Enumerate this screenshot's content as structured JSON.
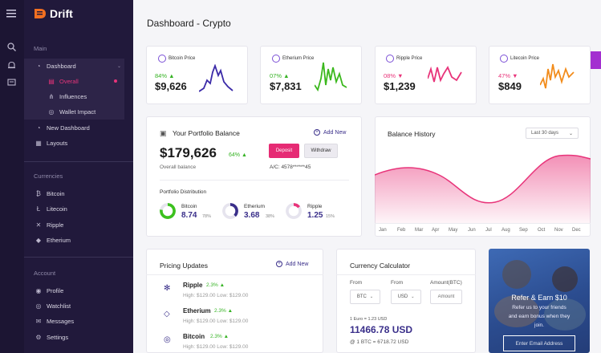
{
  "app": {
    "name": "Drift"
  },
  "page": {
    "title": "Dashboard - Crypto"
  },
  "sidebar": {
    "main_heading": "Main",
    "dashboard": "Dashboard",
    "sub": [
      "Overall",
      "Influences",
      "Wallet Impact"
    ],
    "new_dashboard": "New Dashboard",
    "layouts": "Layouts",
    "currencies_heading": "Currencies",
    "currencies": [
      "Bitcoin",
      "Litecoin",
      "Ripple",
      "Etherium"
    ],
    "account_heading": "Account",
    "account": [
      "Profile",
      "Watchlist",
      "Messages",
      "Settings"
    ]
  },
  "prices": [
    {
      "name": "Bitcoin Price",
      "change": "84%",
      "dir": "up",
      "value": "$9,626",
      "color": "#3b2aa8"
    },
    {
      "name": "Etherium Price",
      "change": "07%",
      "dir": "up",
      "value": "$7,831",
      "color": "#3cb81e"
    },
    {
      "name": "Ripple Price",
      "change": "08%",
      "dir": "down",
      "value": "$1,239",
      "color": "#e8347a"
    },
    {
      "name": "Litecoin Price",
      "change": "47%",
      "dir": "down",
      "value": "$849",
      "color": "#f28c1c"
    }
  ],
  "portfolio": {
    "title": "Your Portfolio Balance",
    "add_new": "Add New",
    "balance": "$179,626",
    "change": "64%",
    "balance_label": "Overall balance",
    "deposit": "Deposit",
    "withdraw": "Withdraw",
    "account": "A/C: 4578******45",
    "distribution_title": "Portfolio Distribution",
    "distribution": [
      {
        "name": "Bitcoin",
        "value": "8.74",
        "pct": "78%",
        "color": "#3cc11e",
        "fill": 0.78
      },
      {
        "name": "Etherium",
        "value": "3.68",
        "pct": "38%",
        "color": "#3a2f8a",
        "fill": 0.38
      },
      {
        "name": "Ripple",
        "value": "1.25",
        "pct": "15%",
        "color": "#e8347a",
        "fill": 0.15
      }
    ]
  },
  "balance_history": {
    "title": "Balance History",
    "range": "Last 30 days",
    "months": [
      "Jan",
      "Feb",
      "Mar",
      "Apr",
      "May",
      "Jun",
      "Jul",
      "Aug",
      "Sep",
      "Oct",
      "Nov",
      "Dec"
    ]
  },
  "pricing": {
    "title": "Pricing Updates",
    "add_new": "Add New",
    "rows": [
      {
        "name": "Ripple",
        "change": "2.3%",
        "hilo": "High: $129.00 Low: $129.00"
      },
      {
        "name": "Etherium",
        "change": "2.3%",
        "hilo": "High: $129.00 Low: $129.00"
      },
      {
        "name": "Bitcoin",
        "change": "2.3%",
        "hilo": "High: $129.00 Low: $129.00"
      }
    ]
  },
  "calculator": {
    "title": "Currency Calculator",
    "from_label": "From",
    "from2_label": "From",
    "amount_label": "Amount(BTC)",
    "from_value": "BTC",
    "to_value": "USD",
    "amount_placeholder": "Amount",
    "rate": "1 Euro = 1.23 USD",
    "result": "11466.78 USD",
    "btc_rate": "@ 1 BTC = 6718.72 USD"
  },
  "refer": {
    "title": "Refer & Earn $10",
    "text1": "Refer us to your friends",
    "text2": "and earn bonus when they",
    "text3": "join.",
    "email_placeholder": "Enter Email Address"
  },
  "colors": {
    "sidebar": "#21193b",
    "accent": "#e62b74",
    "purple": "#3a2f8a",
    "green": "#36b324"
  }
}
